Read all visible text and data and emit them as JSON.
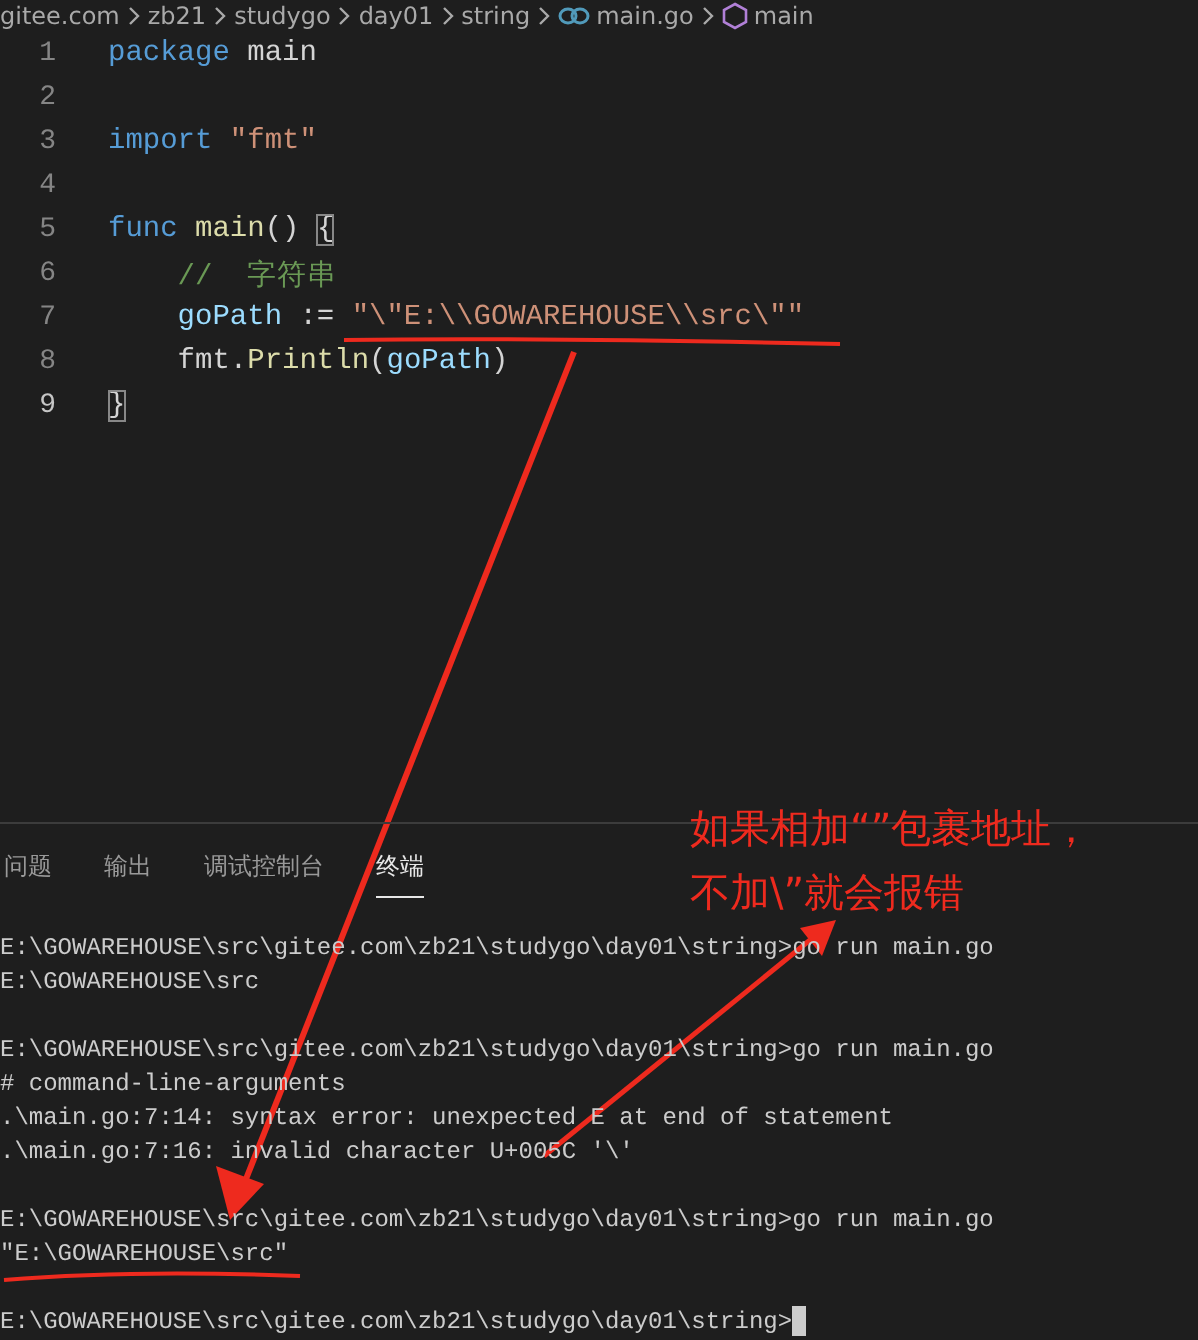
{
  "breadcrumb": [
    {
      "label": "gitee.com",
      "kind": "folder"
    },
    {
      "label": "zb21",
      "kind": "folder"
    },
    {
      "label": "studygo",
      "kind": "folder"
    },
    {
      "label": "day01",
      "kind": "folder"
    },
    {
      "label": "string",
      "kind": "folder"
    },
    {
      "label": "main.go",
      "kind": "go-file"
    },
    {
      "label": "main",
      "kind": "symbol"
    }
  ],
  "code": [
    {
      "number": "1",
      "tokens": [
        {
          "text": "package",
          "kind": "keyword"
        },
        {
          "text": " main",
          "kind": "plain"
        }
      ]
    },
    {
      "number": "2"
    },
    {
      "number": "3",
      "tokens": [
        {
          "text": "import",
          "kind": "keyword"
        },
        {
          "text": " \"fmt\"",
          "kind": "string"
        }
      ]
    },
    {
      "number": "4"
    },
    {
      "number": "5",
      "tokens": [
        {
          "text": "func",
          "kind": "keyword"
        },
        {
          "text": " main",
          "kind": "function"
        },
        {
          "text": "() ",
          "kind": "plain"
        },
        {
          "text": "{",
          "kind": "bracket"
        }
      ]
    },
    {
      "number": "6",
      "tokens": [
        {
          "text": "    //  字符串",
          "kind": "comment"
        }
      ]
    },
    {
      "number": "7",
      "tokens": [
        {
          "text": "    goPath",
          "kind": "variable"
        },
        {
          "text": " := ",
          "kind": "plain"
        },
        {
          "text": "\"\\\"E:\\\\GOWAREHOUSE\\\\src\\\"\"",
          "kind": "string"
        }
      ]
    },
    {
      "number": "8",
      "tokens": [
        {
          "text": "    fmt.",
          "kind": "plain"
        },
        {
          "text": "Println",
          "kind": "function"
        },
        {
          "text": "(",
          "kind": "plain"
        },
        {
          "text": "goPath",
          "kind": "variable"
        },
        {
          "text": ")",
          "kind": "plain"
        }
      ]
    },
    {
      "number": "9",
      "tokens": [
        {
          "text": "}",
          "kind": "bracket"
        }
      ]
    }
  ],
  "panel_tabs": [
    {
      "label": "问题",
      "selected": false
    },
    {
      "label": "输出",
      "selected": false
    },
    {
      "label": "调试控制台",
      "selected": false
    },
    {
      "label": "终端",
      "selected": true
    }
  ],
  "terminal": [
    [
      {
        "text": "E:\\GOWAREHOUSE\\src\\gitee.com\\zb21\\studygo\\day01\\string>go run main.go",
        "cursor": false
      },
      {
        "text": "E:\\GOWAREHOUSE\\src",
        "cursor": false
      }
    ],
    [
      {
        "text": "E:\\GOWAREHOUSE\\src\\gitee.com\\zb21\\studygo\\day01\\string>go run main.go",
        "cursor": false
      },
      {
        "text": "# command-line-arguments",
        "cursor": false
      },
      {
        "text": ".\\main.go:7:14: syntax error: unexpected E at end of statement",
        "cursor": false
      },
      {
        "text": ".\\main.go:7:16: invalid character U+005C '\\'",
        "cursor": false
      }
    ],
    [
      {
        "text": "E:\\GOWAREHOUSE\\src\\gitee.com\\zb21\\studygo\\day01\\string>go run main.go",
        "cursor": false
      },
      {
        "text": "\"E:\\GOWAREHOUSE\\src\"",
        "cursor": false
      }
    ],
    [
      {
        "text": "E:\\GOWAREHOUSE\\src\\gitee.com\\zb21\\studygo\\day01\\string>",
        "cursor": true
      }
    ]
  ],
  "annotation": {
    "text": "如果相加“”包裹地址，不加\\”就会报错"
  }
}
